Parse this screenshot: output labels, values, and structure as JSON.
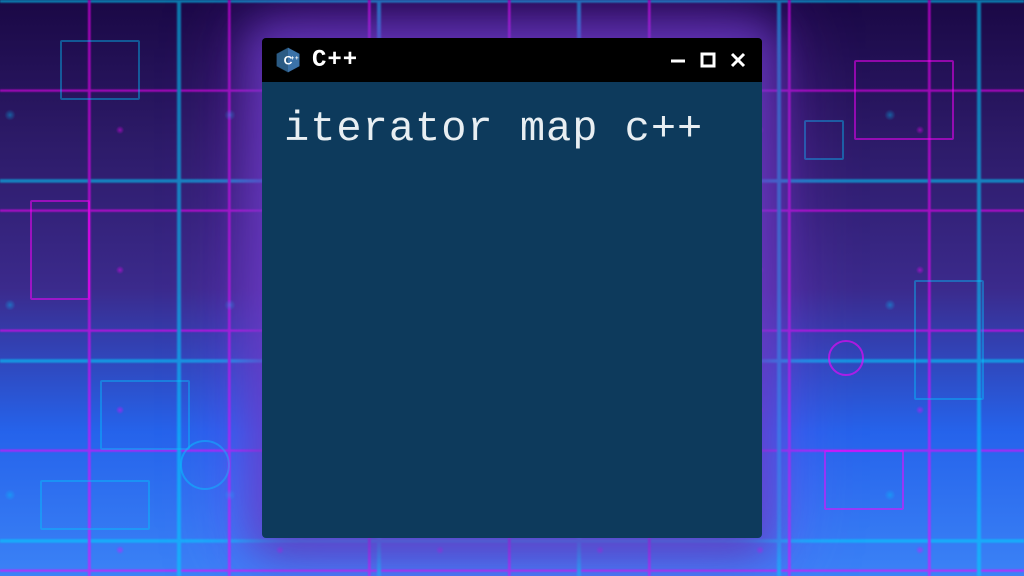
{
  "window": {
    "app_title": "C++",
    "icon_name": "cpp-logo-icon"
  },
  "content": {
    "text": "iterator map c++"
  },
  "colors": {
    "window_bg": "#0d3a5c",
    "titlebar_bg": "#000000",
    "text": "#e8eef2",
    "glow": "#a050ff"
  }
}
